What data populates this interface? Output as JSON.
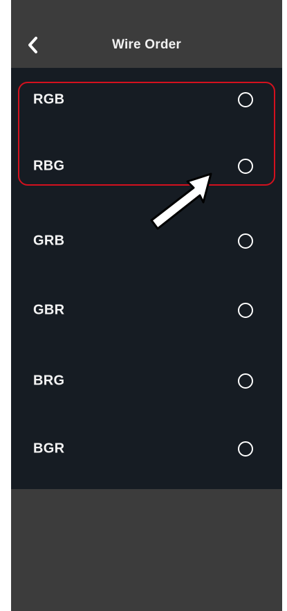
{
  "header": {
    "title": "Wire Order",
    "back_icon": "chevron-left-icon"
  },
  "options": [
    {
      "label": "RGB",
      "selected": false
    },
    {
      "label": "RBG",
      "selected": false
    },
    {
      "label": "GRB",
      "selected": false
    },
    {
      "label": "GBR",
      "selected": false
    },
    {
      "label": "BRG",
      "selected": false
    },
    {
      "label": "BGR",
      "selected": false
    }
  ],
  "colors": {
    "screen_bg": "#3c3c3c",
    "list_bg": "#161c23",
    "highlight": "#d4111e",
    "text": "#f4f4f4"
  }
}
